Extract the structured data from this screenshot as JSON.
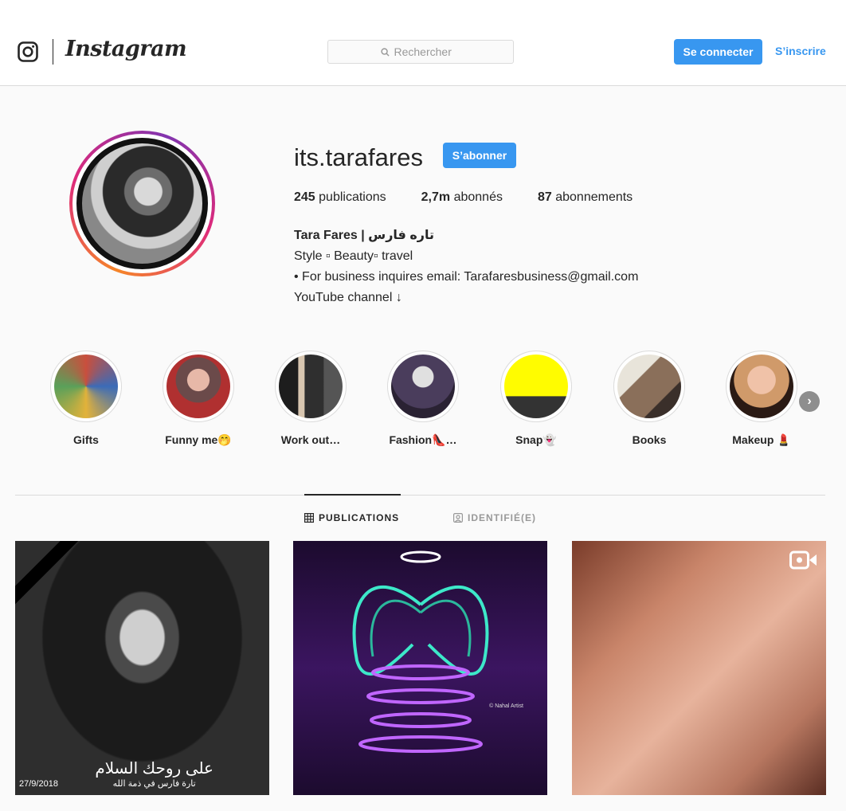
{
  "header": {
    "wordmark": "Instagram",
    "search_placeholder": "Rechercher",
    "login_label": "Se connecter",
    "signup_label": "S’inscrire"
  },
  "profile": {
    "username": "its.tarafares",
    "follow_label": "S’abonner",
    "stats": {
      "posts_value": "245",
      "posts_label": "publications",
      "followers_value": "2,7m",
      "followers_label": "abonnés",
      "following_value": "87",
      "following_label": "abonnements"
    },
    "bio": {
      "full_name": "Tara Fares | تاره فارس",
      "line1": "Style ▫ Beauty▫ travel",
      "line2": "• For business inquires email: Tarafaresbusiness@gmail.com",
      "line3": "YouTube channel ↓"
    }
  },
  "highlights": [
    {
      "label": "Gifts",
      "color": "#c94f3d"
    },
    {
      "label": "Funny me🤭",
      "color": "#6b4a4a"
    },
    {
      "label": "Work out…",
      "color": "#2f2f2f"
    },
    {
      "label": "Fashion👠…",
      "color": "#4a3d5c"
    },
    {
      "label": "Snap👻",
      "color": "#fffc00"
    },
    {
      "label": "Books",
      "color": "#8a6f5a"
    },
    {
      "label": "Makeup 💄",
      "color": "#d09a6a"
    }
  ],
  "tabs": {
    "publications": "PUBLICATIONS",
    "tagged": "IDENTIFIÉ(E)"
  },
  "posts": {
    "p1_date": "27/9/2018",
    "p1_ar_line1": "على روحك السلام",
    "p1_ar_line2": "تارة فارس في ذمة الله",
    "p2_credit": "© Nahal Artist"
  },
  "colors": {
    "accent": "#3897f0",
    "text": "#262626",
    "muted": "#999999",
    "border": "#dbdbdb"
  }
}
